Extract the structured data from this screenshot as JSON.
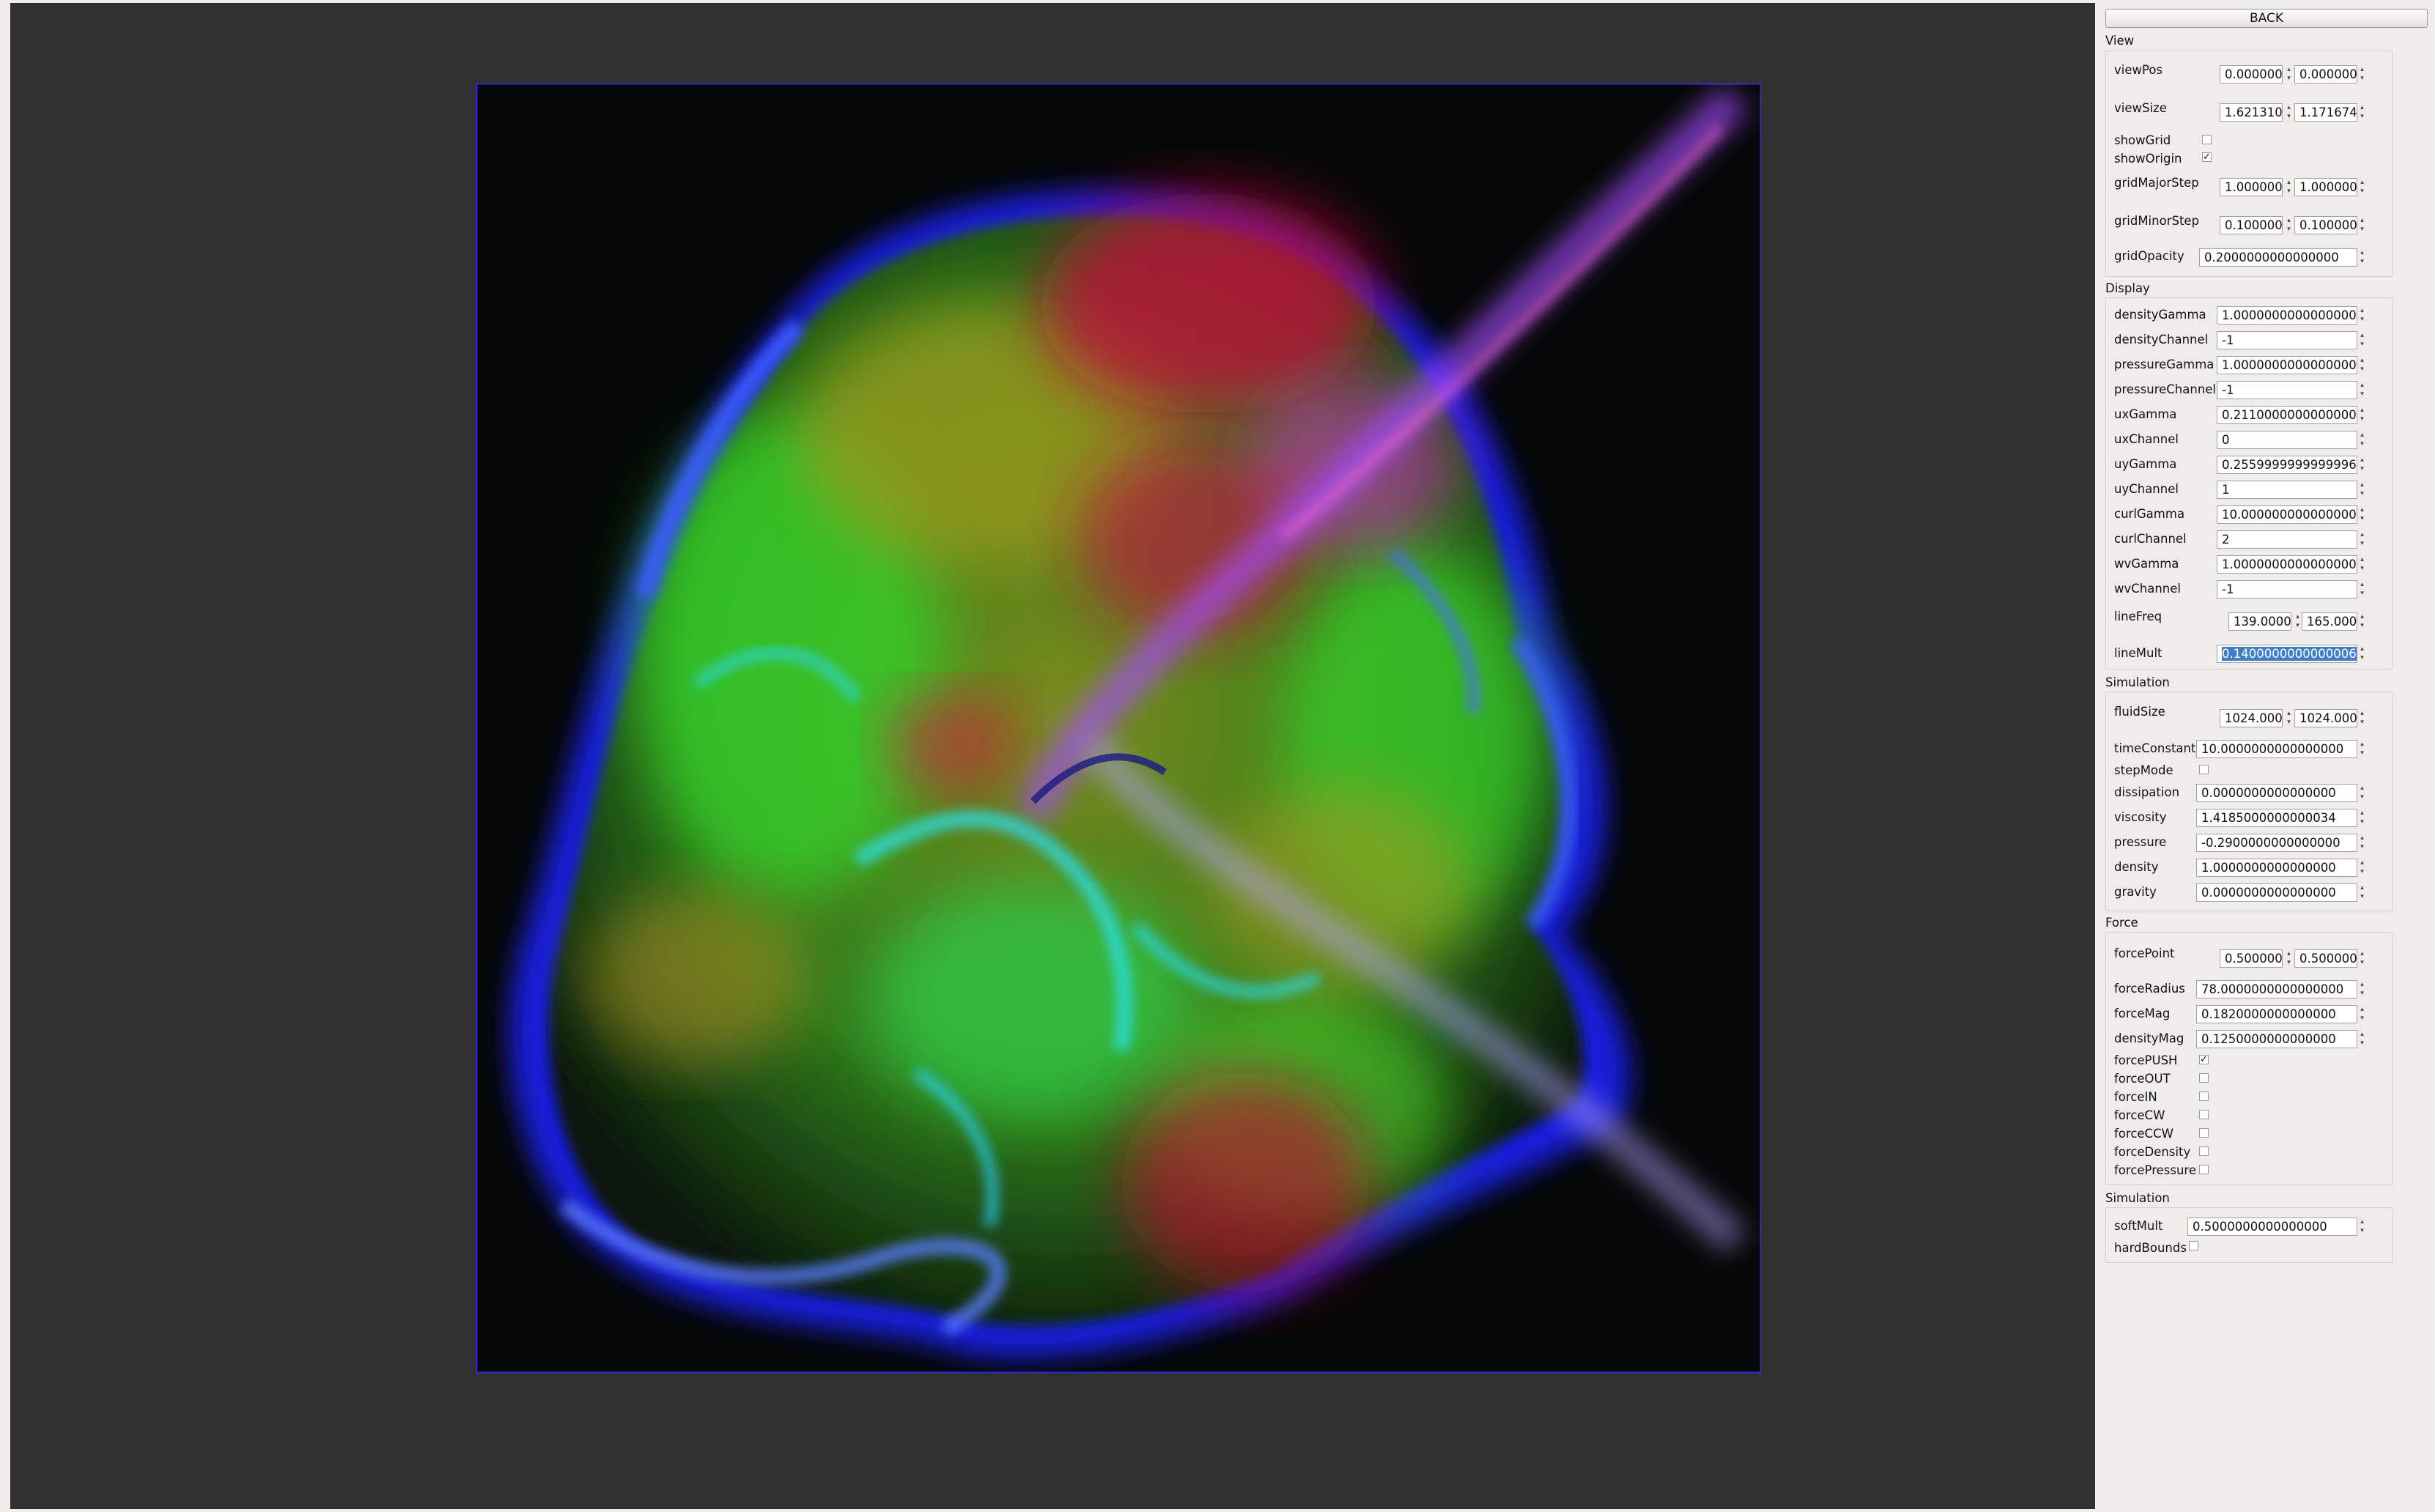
{
  "back_label": "BACK",
  "sections": {
    "view": "View",
    "display": "Display",
    "simulation": "Simulation",
    "force": "Force",
    "simulation2": "Simulation"
  },
  "view": {
    "viewPos": {
      "label": "viewPos",
      "x": "0.000000",
      "y": "0.000000"
    },
    "viewSize": {
      "label": "viewSize",
      "x": "1.621310",
      "y": "1.171674"
    },
    "showGrid": {
      "label": "showGrid",
      "checked": false
    },
    "showOrigin": {
      "label": "showOrigin",
      "checked": true
    },
    "gridMajorStep": {
      "label": "gridMajorStep",
      "x": "1.000000",
      "y": "1.000000"
    },
    "gridMinorStep": {
      "label": "gridMinorStep",
      "x": "0.100000",
      "y": "0.100000"
    },
    "gridOpacity": {
      "label": "gridOpacity",
      "value": "0.2000000000000000"
    }
  },
  "display": {
    "densityGamma": {
      "label": "densityGamma",
      "value": "1.0000000000000000"
    },
    "densityChannel": {
      "label": "densityChannel",
      "value": "-1"
    },
    "pressureGamma": {
      "label": "pressureGamma",
      "value": "1.0000000000000000"
    },
    "pressureChannel": {
      "label": "pressureChannel",
      "value": "-1"
    },
    "uxGamma": {
      "label": "uxGamma",
      "value": "0.2110000000000000"
    },
    "uxChannel": {
      "label": "uxChannel",
      "value": "0"
    },
    "uyGamma": {
      "label": "uyGamma",
      "value": "0.2559999999999996"
    },
    "uyChannel": {
      "label": "uyChannel",
      "value": "1"
    },
    "curlGamma": {
      "label": "curlGamma",
      "value": "10.0000000000000000"
    },
    "curlChannel": {
      "label": "curlChannel",
      "value": "2"
    },
    "wvGamma": {
      "label": "wvGamma",
      "value": "1.0000000000000000"
    },
    "wvChannel": {
      "label": "wvChannel",
      "value": "-1"
    },
    "lineFreq": {
      "label": "lineFreq",
      "x": "139.0000",
      "y": "165.0000"
    },
    "lineMult": {
      "label": "lineMult",
      "value": "0.1400000000000006"
    }
  },
  "simulation": {
    "fluidSize": {
      "label": "fluidSize",
      "x": "1024.000",
      "y": "1024.000"
    },
    "timeConstant": {
      "label": "timeConstant",
      "value": "10.0000000000000000"
    },
    "stepMode": {
      "label": "stepMode",
      "checked": false
    },
    "dissipation": {
      "label": "dissipation",
      "value": "0.0000000000000000"
    },
    "viscosity": {
      "label": "viscosity",
      "value": "1.4185000000000034"
    },
    "pressure": {
      "label": "pressure",
      "value": "-0.2900000000000000"
    },
    "density": {
      "label": "density",
      "value": "1.0000000000000000"
    },
    "gravity": {
      "label": "gravity",
      "value": "0.0000000000000000"
    }
  },
  "force": {
    "forcePoint": {
      "label": "forcePoint",
      "x": "0.500000",
      "y": "0.500000"
    },
    "forceRadius": {
      "label": "forceRadius",
      "value": "78.0000000000000000"
    },
    "forceMag": {
      "label": "forceMag",
      "value": "0.1820000000000000"
    },
    "densityMag": {
      "label": "densityMag",
      "value": "0.1250000000000000"
    },
    "forcePUSH": {
      "label": "forcePUSH",
      "checked": true
    },
    "forceOUT": {
      "label": "forceOUT",
      "checked": false
    },
    "forceIN": {
      "label": "forceIN",
      "checked": false
    },
    "forceCW": {
      "label": "forceCW",
      "checked": false
    },
    "forceCCW": {
      "label": "forceCCW",
      "checked": false
    },
    "forceDensity": {
      "label": "forceDensity",
      "checked": false
    },
    "forcePressure": {
      "label": "forcePressure",
      "checked": false
    }
  },
  "simulation2": {
    "softMult": {
      "label": "softMult",
      "value": "0.5000000000000000"
    },
    "hardBounds": {
      "label": "hardBounds",
      "checked": false
    }
  },
  "colors": {
    "viewport_bg": "#313131",
    "panel_bg": "#efedea",
    "selection": "#3f7fc8",
    "fluid_green": "#3fcf2a",
    "fluid_blue": "#3a3cff",
    "fluid_red": "#c8102a",
    "fluid_cyan": "#2ad8e8"
  }
}
